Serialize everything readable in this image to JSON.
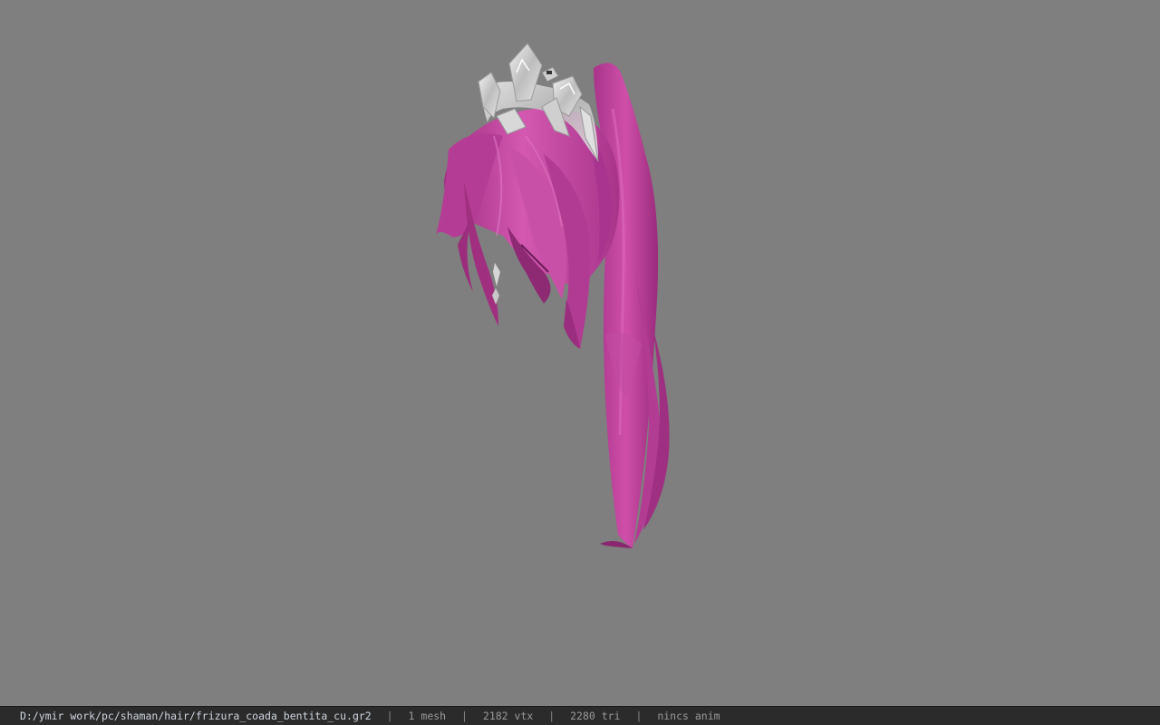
{
  "viewport": {
    "background": "#7f7f7f",
    "model": {
      "hair_color": "#c2449e",
      "tiara_color": "#d8d8d8"
    }
  },
  "statusbar": {
    "file_path": "D:/ymir work/pc/shaman/hair/frizura_coada_bentita_cu.gr2",
    "separator": "|",
    "mesh_count": "1 mesh",
    "vertex_count": "2182 vtx",
    "triangle_count": "2280 tri",
    "animation": "nincs anim"
  }
}
